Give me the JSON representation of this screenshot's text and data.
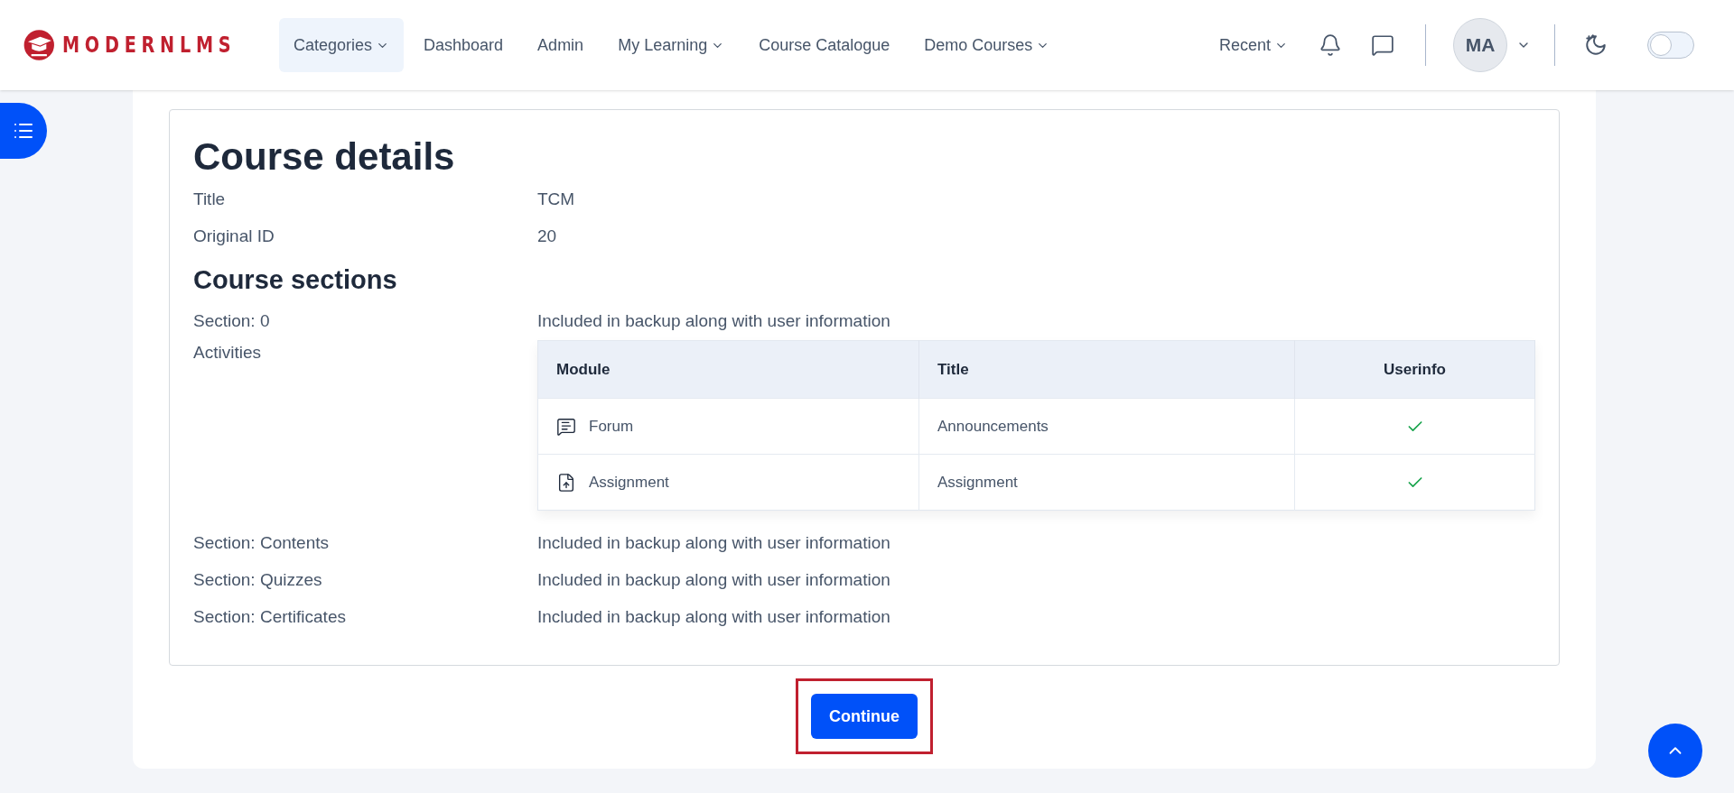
{
  "header": {
    "logo_text": "MODERNLMS",
    "nav": [
      {
        "label": "Categories",
        "dropdown": true,
        "selected": true
      },
      {
        "label": "Dashboard",
        "dropdown": false,
        "selected": false
      },
      {
        "label": "Admin",
        "dropdown": false,
        "selected": false
      },
      {
        "label": "My Learning",
        "dropdown": true,
        "selected": false
      },
      {
        "label": "Course Catalogue",
        "dropdown": false,
        "selected": false
      },
      {
        "label": "Demo Courses",
        "dropdown": true,
        "selected": false
      }
    ],
    "recent": "Recent",
    "avatar": "MA",
    "dark_mode": {
      "on": false
    }
  },
  "course_details": {
    "heading": "Course details",
    "fields": [
      {
        "label": "Title",
        "value": "TCM"
      },
      {
        "label": "Original ID",
        "value": "20"
      }
    ]
  },
  "course_sections": {
    "heading": "Course sections",
    "sections": [
      {
        "label": "Section: 0",
        "value": "Included in backup along with user information"
      },
      {
        "label": "Activities",
        "kind": "table",
        "table": {
          "columns": [
            "Module",
            "Title",
            "Userinfo"
          ],
          "rows": [
            {
              "kind": "forum",
              "module": "Forum",
              "title": "Announcements",
              "userinfo": true
            },
            {
              "kind": "assignment",
              "module": "Assignment",
              "title": "Assignment",
              "userinfo": true
            }
          ]
        }
      },
      {
        "label": "Section: Contents",
        "value": "Included in backup along with user information"
      },
      {
        "label": "Section: Quizzes",
        "value": "Included in backup along with user information"
      },
      {
        "label": "Section: Certificates",
        "value": "Included in backup along with user information"
      }
    ]
  },
  "continue_button": {
    "label": "Continue",
    "highlighted": true
  }
}
